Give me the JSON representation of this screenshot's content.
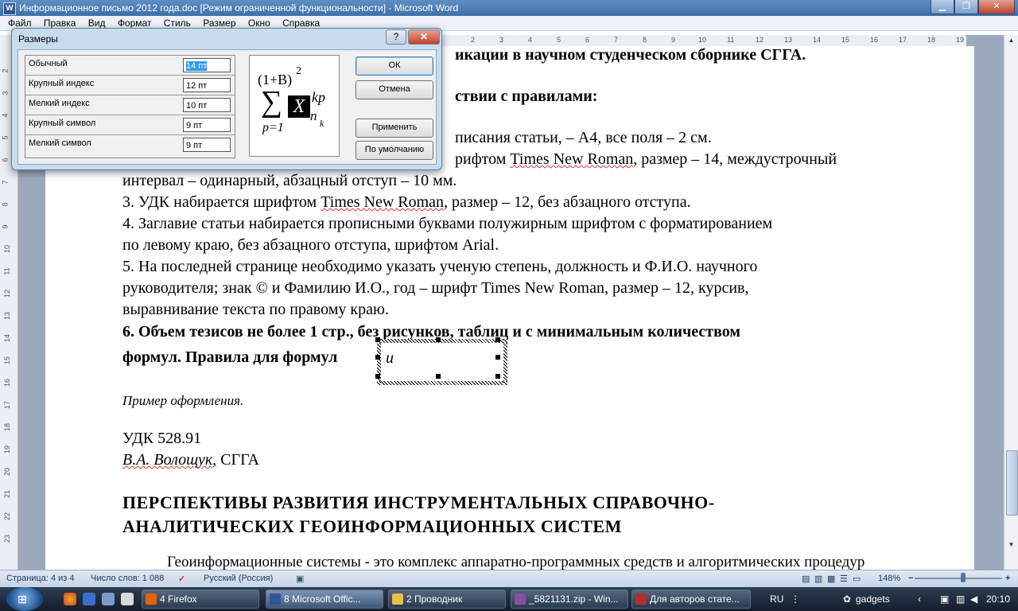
{
  "window": {
    "title": "Информационное письмо 2012 года.doc [Режим ограниченной функциональности] - Microsoft Word",
    "app_icon": "W"
  },
  "menu": [
    "Файл",
    "Правка",
    "Вид",
    "Формат",
    "Стиль",
    "Размер",
    "Окно",
    "Справка"
  ],
  "ruler_numbers": [
    "2",
    "3",
    "4",
    "5",
    "6",
    "7",
    "8",
    "9",
    "10",
    "11",
    "12",
    "13",
    "14",
    "15",
    "16",
    "17",
    "18",
    "19"
  ],
  "vruler_numbers": [
    "2",
    "3",
    "4",
    "5",
    "6",
    "7",
    "8",
    "9",
    "10",
    "11",
    "12",
    "13",
    "14",
    "15",
    "16",
    "17",
    "18",
    "19",
    "20",
    "21",
    "22",
    "23"
  ],
  "document": {
    "line1": "икации в научном студенческом сборнике СГГА.",
    "line2": "ствии с правилами:",
    "line3": "писания статьи, – А4, все поля – 2 см.",
    "line4_pre": "рифтом ",
    "line4_font": "Times New Roman",
    "line4_post": ", размер – 14, междустрочный",
    "line5": "интервал – одинарный, абзацный отступ – 10 мм.",
    "item3_pre": "3.  УДК набирается шрифтом ",
    "item3_font": "Times New Roman",
    "item3_post": ", размер – 12, без абзацного отступа.",
    "item4a": "4.  Заглавие статьи набирается прописными буквами полужирным шрифтом с форматированием",
    "item4b": "по левому краю, без абзацного отступа, шрифтом Arial.",
    "item5a": "5. На последней странице необходимо указать ученую степень,  должность и Ф.И.О. научного",
    "item5b": "руководителя;  знак © и Фамилию И.О., год – шрифт Times New Roman, размер – 12, курсив,",
    "item5c": "выравнивание текста по правому краю.",
    "item6a": "6.  Объем тезисов не более 1 стр., без рисунков, таблиц и с минимальным количеством",
    "item6b": "формул. Правила для формул",
    "eq_cursor": "u",
    "example": "Пример оформления.",
    "udk": "УДК 528.91",
    "author": "В.А. Волощук,",
    "org": " СГГА",
    "heading1": "ПЕРСПЕКТИВЫ РАЗВИТИЯ ИНСТРУМЕНТАЛЬНЫХ СПРАВОЧНО-",
    "heading2": "АНАЛИТИЧЕСКИХ ГЕОИНФОРМАЦИОННЫХ СИСТЕМ",
    "body_start": "Геоинформационные системы - это комплекс аппаратно-программных средств и алгоритмических процедур"
  },
  "dialog": {
    "title": "Размеры",
    "help": "?",
    "close": "✕",
    "rows": [
      {
        "label": "Обычный",
        "value": "14 пт",
        "selected": true
      },
      {
        "label": "Крупный индекс",
        "value": "12 пт",
        "selected": false
      },
      {
        "label": "Мелкий индекс",
        "value": "10 пт",
        "selected": false
      },
      {
        "label": "Крупный символ",
        "value": "9 пт",
        "selected": false
      },
      {
        "label": "Мелкий символ",
        "value": "9 пт",
        "selected": false
      }
    ],
    "preview": {
      "paren": "(1+B)",
      "exp": "2",
      "sigma": "∑",
      "x": "X",
      "sup": "kp",
      "sub": "n",
      "subsub": "k",
      "lower": "p=1"
    },
    "buttons": {
      "ok": "ОК",
      "cancel": "Отмена",
      "apply": "Применить",
      "default": "По умолчанию"
    }
  },
  "statusbar": {
    "page": "Страница: 4 из 4",
    "words": "Число слов: 1 088",
    "lang": "Русский (Россия)",
    "zoom": "148%",
    "zoom_minus": "−",
    "zoom_plus": "+"
  },
  "taskbar": {
    "tasks": [
      {
        "label": "4 Firefox",
        "color": "#e66000"
      },
      {
        "label": "8 Microsoft Offic...",
        "color": "#2b5797"
      },
      {
        "label": "2 Проводник",
        "color": "#e8c040"
      },
      {
        "label": "_5821131.zip - Win...",
        "color": "#8a4fa0"
      },
      {
        "label": "Для авторов стате...",
        "color": "#b03030"
      }
    ],
    "lang": "RU",
    "gadgets": "gadgets",
    "clock": "20:10"
  }
}
